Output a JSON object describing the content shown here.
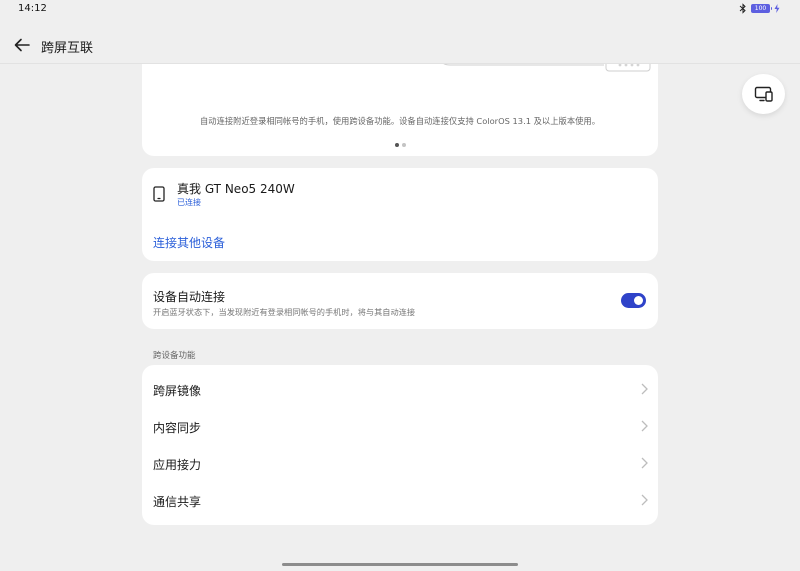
{
  "status_bar": {
    "time": "14:12",
    "battery": "100",
    "icons": [
      "bluetooth-icon",
      "battery-icon",
      "charging-icon"
    ]
  },
  "header": {
    "title": "跨屏互联",
    "back_icon": "arrow-left-icon"
  },
  "float_button": {
    "icon": "screen-cast-icon"
  },
  "banner": {
    "description": "自动连接附近登录相同帐号的手机，使用跨设备功能。设备自动连接仅支持 ColorOS 13.1 及以上版本使用。",
    "page_count": 2,
    "active_page": 1
  },
  "device": {
    "icon": "phone-icon",
    "name": "真我 GT Neo5 240W",
    "status": "已连接",
    "connect_other": "连接其他设备"
  },
  "auto_connect": {
    "title": "设备自动连接",
    "description": "开启蓝牙状态下，当发现附近有登录相同帐号的手机时，将与其自动连接",
    "enabled": true
  },
  "features": {
    "section_label": "跨设备功能",
    "items": [
      {
        "label": "跨屏镜像"
      },
      {
        "label": "内容同步"
      },
      {
        "label": "应用接力"
      },
      {
        "label": "通信共享"
      }
    ]
  },
  "colors": {
    "accent": "#2b5fd9",
    "toggle_on": "#2f43c9",
    "background": "#efefef",
    "card": "#ffffff"
  }
}
